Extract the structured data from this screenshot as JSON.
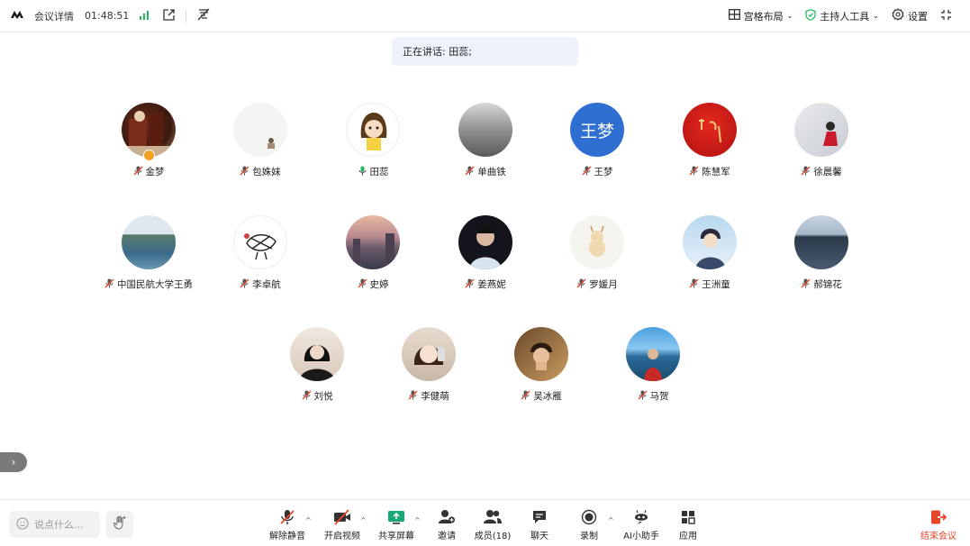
{
  "topbar": {
    "meeting_details": "会议详情",
    "timer": "01:48:51",
    "layout": "宫格布局",
    "host_tools": "主持人工具",
    "settings": "设置"
  },
  "speaking": "正在讲话: 田蕊;",
  "participants": [
    {
      "name": "金梦",
      "mic": "muted",
      "host": true,
      "avatar": "photo-art"
    },
    {
      "name": "包姝妹",
      "mic": "muted",
      "avatar": "photo-pale"
    },
    {
      "name": "田蕊",
      "mic": "speaking",
      "avatar": "cartoon-girl"
    },
    {
      "name": "单曲铁",
      "mic": "muted",
      "avatar": "photo-grey"
    },
    {
      "name": "王梦",
      "mic": "muted",
      "avatar": "text",
      "avatar_text": "王梦",
      "avatar_color": "#2f6fd1"
    },
    {
      "name": "陈慧军",
      "mic": "muted",
      "avatar": "photo-red"
    },
    {
      "name": "徐晨馨",
      "mic": "muted",
      "avatar": "photo-snow"
    },
    {
      "name": "中国民航大学王勇",
      "mic": "muted",
      "avatar": "photo-lake"
    },
    {
      "name": "李卓航",
      "mic": "muted",
      "avatar": "sketch"
    },
    {
      "name": "史婷",
      "mic": "muted",
      "avatar": "photo-sunset"
    },
    {
      "name": "姜燕妮",
      "mic": "muted",
      "avatar": "photo-dark"
    },
    {
      "name": "罗媛月",
      "mic": "muted",
      "avatar": "cartoon-cat"
    },
    {
      "name": "王洲童",
      "mic": "muted",
      "avatar": "anime-boy"
    },
    {
      "name": "郝锦花",
      "mic": "muted",
      "avatar": "photo-sea"
    },
    {
      "name": "刘悦",
      "mic": "muted",
      "avatar": "photo-woman"
    },
    {
      "name": "李健萌",
      "mic": "muted",
      "avatar": "photo-girl"
    },
    {
      "name": "吴冰雁",
      "mic": "muted",
      "avatar": "photo-boy"
    },
    {
      "name": "马贺",
      "mic": "muted",
      "avatar": "photo-man"
    }
  ],
  "bottombar": {
    "say_placeholder": "说点什么...",
    "unmute": "解除静音",
    "start_video": "开启视频",
    "share_screen": "共享屏幕",
    "invite": "邀请",
    "members": "成员(18)",
    "chat": "聊天",
    "record": "录制",
    "ai_assistant": "AI小助手",
    "apps": "应用",
    "end_meeting": "结束会议"
  },
  "colors": {
    "accent": "#2f6fd1",
    "danger": "#e5452b",
    "signal": "#1fb860",
    "muted": "#e5452b"
  }
}
